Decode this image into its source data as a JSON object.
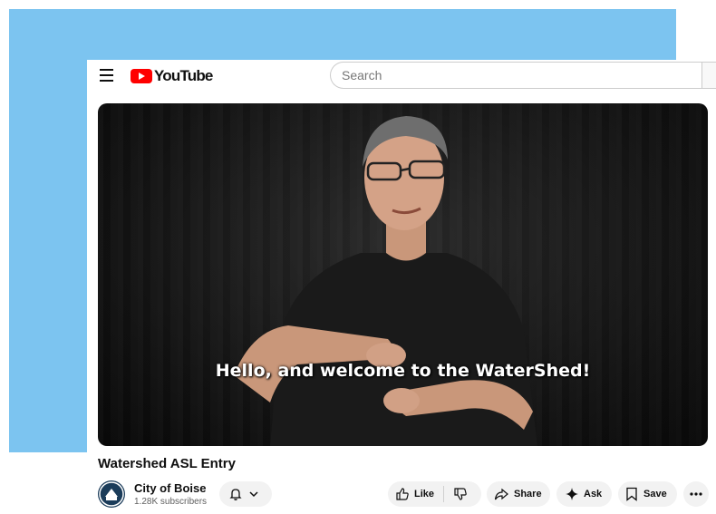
{
  "header": {
    "logo_text": "YouTube",
    "search_placeholder": "Search"
  },
  "video": {
    "caption": "Hello, and welcome to the WaterShed!",
    "title": "Watershed ASL Entry"
  },
  "channel": {
    "name": "City of Boise",
    "subscribers": "1.28K subscribers"
  },
  "actions": {
    "like_label": "Like",
    "share_label": "Share",
    "ask_label": "Ask",
    "save_label": "Save"
  },
  "colors": {
    "backdrop": "#7cc4f0",
    "brand_red": "#ff0000",
    "pill_bg": "#f2f2f2"
  }
}
